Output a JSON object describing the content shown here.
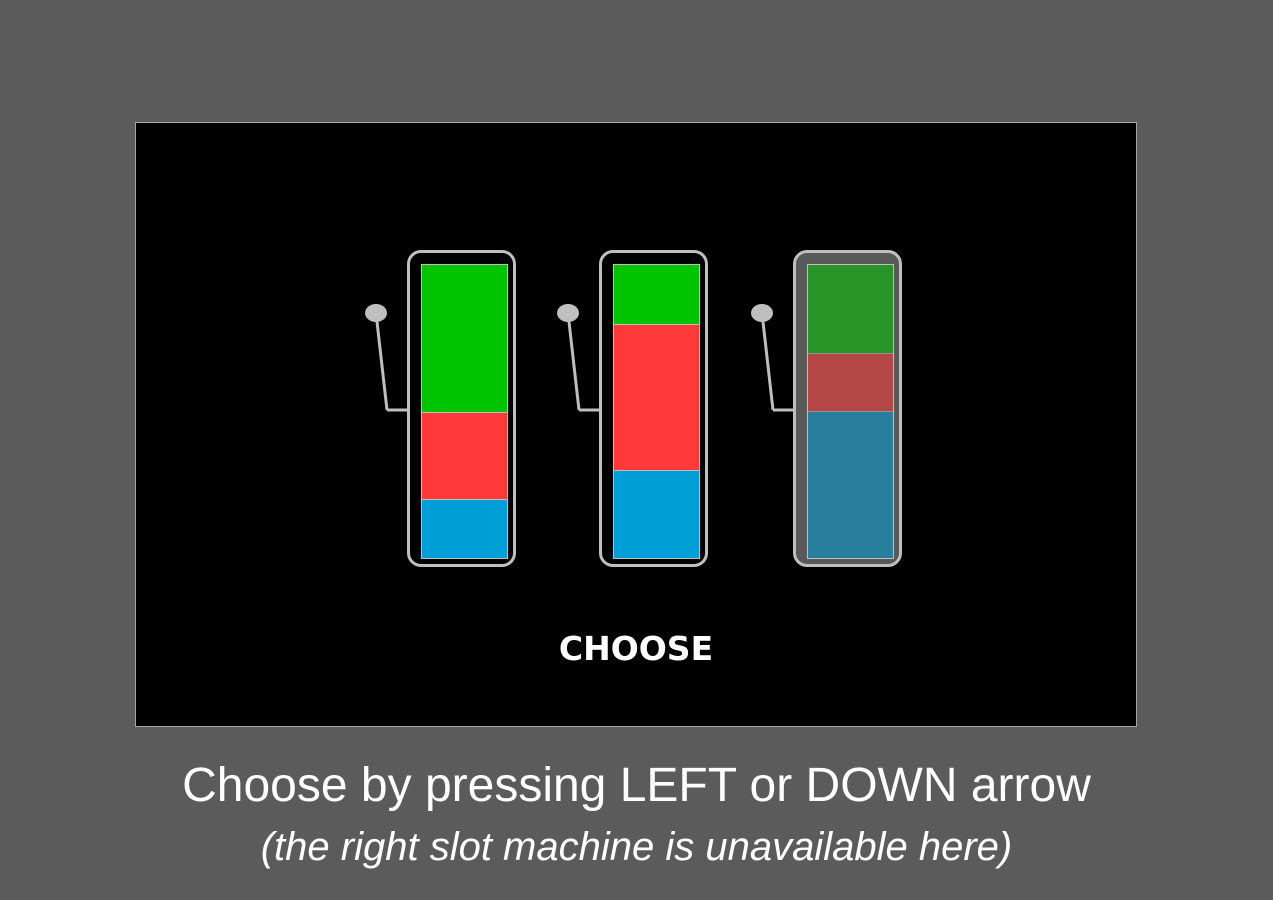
{
  "instruction": "Choose by pressing LEFT or DOWN arrow",
  "note": "(the right slot machine is unavailable here)",
  "prompt": "CHOOSE",
  "colors": {
    "background": "#5b5b5b",
    "stage": "#000000",
    "outline": "#bfbfbf",
    "green": "#00c400",
    "red": "#ff3838",
    "blue": "#009ed6"
  },
  "machines": [
    {
      "id": "left",
      "available": true,
      "segments": [
        {
          "color": "green",
          "fraction": 0.5
        },
        {
          "color": "red",
          "fraction": 0.3
        },
        {
          "color": "blue",
          "fraction": 0.2
        }
      ]
    },
    {
      "id": "middle",
      "available": true,
      "segments": [
        {
          "color": "green",
          "fraction": 0.2
        },
        {
          "color": "red",
          "fraction": 0.5
        },
        {
          "color": "blue",
          "fraction": 0.3
        }
      ]
    },
    {
      "id": "right",
      "available": false,
      "segments": [
        {
          "color": "green",
          "fraction": 0.3
        },
        {
          "color": "red",
          "fraction": 0.2
        },
        {
          "color": "blue",
          "fraction": 0.5
        }
      ]
    }
  ]
}
